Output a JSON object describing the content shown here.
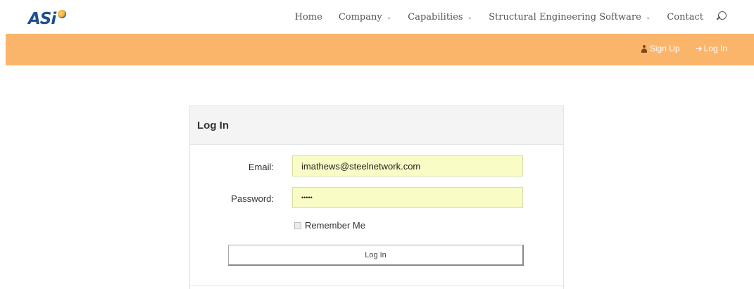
{
  "brand": {
    "logo_text": "ASi"
  },
  "nav": {
    "items": [
      {
        "label": "Home",
        "dropdown": false
      },
      {
        "label": "Company",
        "dropdown": true
      },
      {
        "label": "Capabilities",
        "dropdown": true
      },
      {
        "label": "Structural Engineering Software",
        "dropdown": true
      },
      {
        "label": "Contact",
        "dropdown": false
      }
    ],
    "search_icon": "search-icon"
  },
  "auth": {
    "signup_label": "Sign Up",
    "signup_icon": "user-icon",
    "login_label": "Log In",
    "login_icon": "sign-in-icon"
  },
  "login_form": {
    "title": "Log In",
    "email_label": "Email:",
    "email_value": "imathews@steelnetwork.com",
    "password_label": "Password:",
    "password_value": "•••••",
    "remember_label": "Remember Me",
    "remember_checked": false,
    "submit_label": "Log In"
  },
  "colors": {
    "accent_bar": "#fbb56b",
    "autofill_bg": "#fafcc6",
    "logo_blue": "#1f4f8e"
  }
}
